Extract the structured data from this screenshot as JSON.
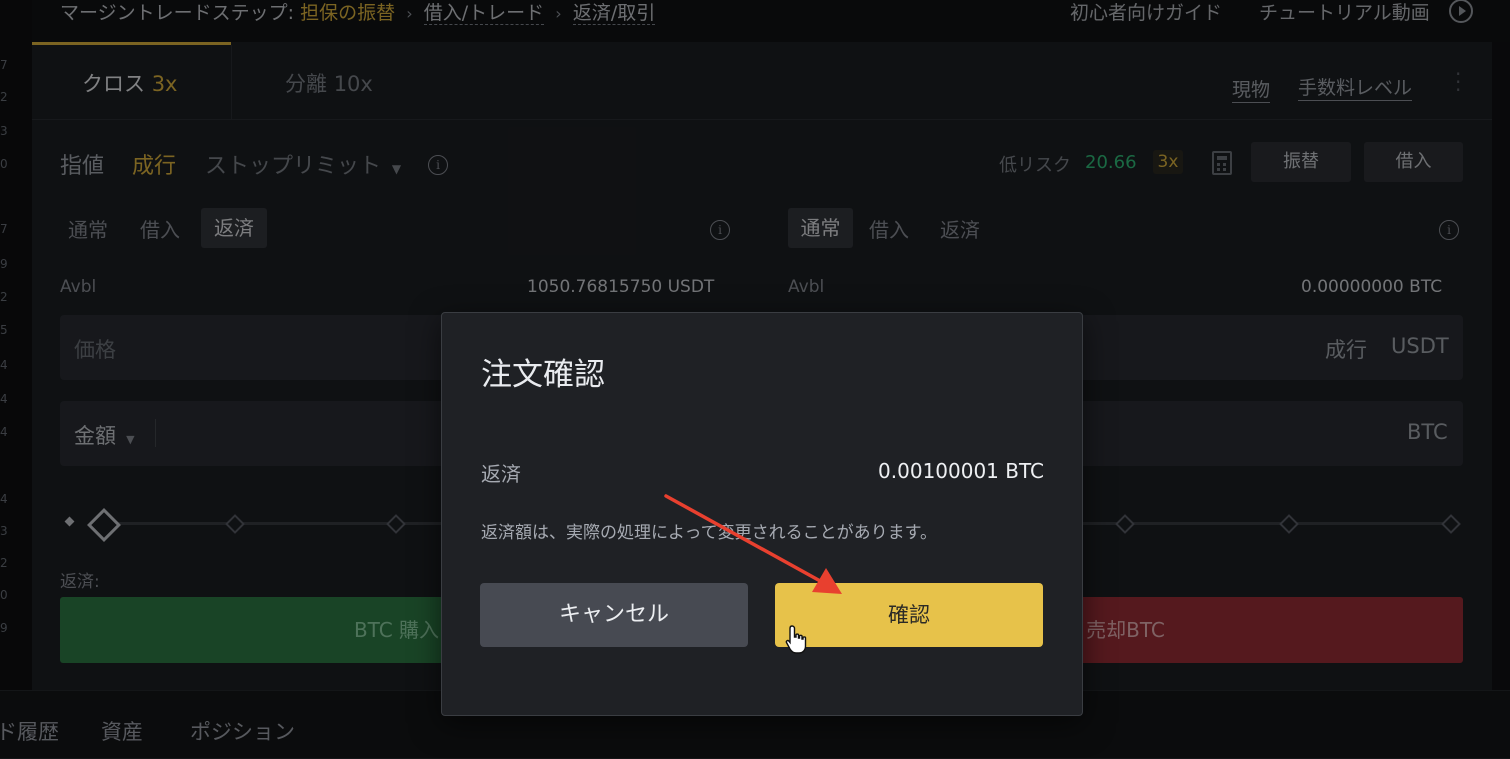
{
  "left_strip_numbers": [
    "7",
    "2",
    "3",
    "0",
    "",
    "7",
    "9",
    "2",
    "5",
    "4",
    "4",
    "4",
    "",
    "4",
    "3",
    "2",
    "0",
    "9"
  ],
  "breadcrumb": {
    "prefix": "マージントレードステップ:",
    "step1": "担保の振替",
    "step2": "借入/トレード",
    "step3": "返済/取引",
    "guide": "初心者向けガイド",
    "tutorial": "チュートリアル動画"
  },
  "mode_tabs": {
    "cross_label": "クロス",
    "cross_leverage": "3x",
    "isolated_label": "分離",
    "isolated_leverage": "10x",
    "spot_link": "現物",
    "fee_link": "手数料レベル"
  },
  "order_types": {
    "limit": "指値",
    "market": "成行",
    "stop_limit": "ストップリミット"
  },
  "risk": {
    "label": "低リスク",
    "value": "20.66",
    "leverage": "3x",
    "transfer_button": "振替",
    "borrow_button": "借入"
  },
  "buy_side": {
    "sub_tabs": [
      "通常",
      "借入",
      "返済"
    ],
    "active_sub_tab": "返済",
    "avbl_label": "Avbl",
    "avbl_value": "1050.76815750 USDT",
    "price_placeholder": "価格",
    "amount_label": "金額",
    "repay_label": "返済:",
    "button": "BTC 購入"
  },
  "sell_side": {
    "sub_tabs": [
      "通常",
      "借入",
      "返済"
    ],
    "active_sub_tab": "通常",
    "avbl_label": "Avbl",
    "avbl_value": "0.00000000 BTC",
    "price_mode": "成行",
    "price_unit": "USDT",
    "amount_unit": "BTC",
    "button": "売却BTC"
  },
  "bottom_tabs": [
    "ド履歴",
    "資産",
    "ポジション"
  ],
  "dialog": {
    "title": "注文確認",
    "row_label": "返済",
    "row_value": "0.00100001 BTC",
    "note": "返済額は、実際の処理によって変更されることがあります。",
    "cancel": "キャンセル",
    "confirm": "確認"
  },
  "colors": {
    "accent_gold": "#e0b63e",
    "confirm_button": "#e7c24a",
    "buy_green": "#2f7d45",
    "sell_red": "#9b2f37",
    "annotation_arrow": "#e8402f"
  },
  "icons": [
    "play-circle-icon",
    "chevron-right-icon",
    "caret-down-icon",
    "info-icon",
    "calculator-icon",
    "more-vertical-icon",
    "hand-cursor-icon"
  ]
}
